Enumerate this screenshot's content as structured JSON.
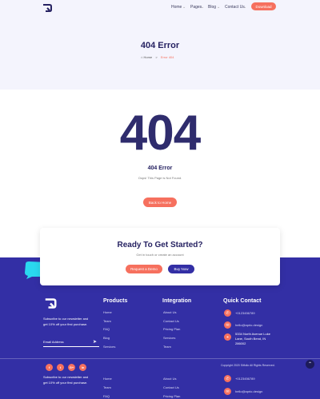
{
  "nav": {
    "items": [
      "Home",
      "Pages",
      "Blog",
      "Contact Us"
    ],
    "download": "Download"
  },
  "hero": {
    "title": "404 Error",
    "crumb_home": "Home",
    "crumb_sep": ">",
    "crumb_current": "Error 404"
  },
  "error": {
    "code": "404",
    "title": "404 Error",
    "message": "Oops! This Page is Not Found.",
    "back": "Back to Home"
  },
  "cta": {
    "title": "Ready To Get Started?",
    "subtitle": "Get in touch or create an account",
    "demo": "Request a Demo",
    "buy": "Buy Now"
  },
  "footer": {
    "newsletter_text": [
      "Subscribe to our newsletter and",
      "get 10% off your first purchase."
    ],
    "email_placeholder": "Email Address",
    "products_title": "Products",
    "products": [
      "Home",
      "Team",
      "FAQ",
      "Blog",
      "Services"
    ],
    "integration_title": "Integration",
    "integration": [
      "About Us",
      "Contact Us",
      "Pricing Plan",
      "Services",
      "Team"
    ],
    "contact_title": "Quick Contact",
    "phone": "+0123456789",
    "email": "hello@aprio.design",
    "address": [
      "5334 North Avenue Luke",
      "Lane, South Bend, IN",
      "286002"
    ],
    "copyright": "Copyright 2020 Sitfolio All Rights Reserved."
  },
  "footer_dup": {
    "newsletter_text": [
      "Subscribe to our newsletter and",
      "get 10% off your first purchase."
    ],
    "products": [
      "Home",
      "Team",
      "FAQ"
    ],
    "integration": [
      "About Us",
      "Contact Us",
      "Pricing Plan"
    ],
    "phone": "+0123456789",
    "email": "hello@aprio.design"
  },
  "social": [
    "f",
    "t",
    "G+",
    "in"
  ],
  "colors": {
    "accent": "#f6705e",
    "brand": "#332fa5",
    "dark": "#262262",
    "hero_bg": "#f4f4fd",
    "bubble": "#2ad8ef"
  }
}
